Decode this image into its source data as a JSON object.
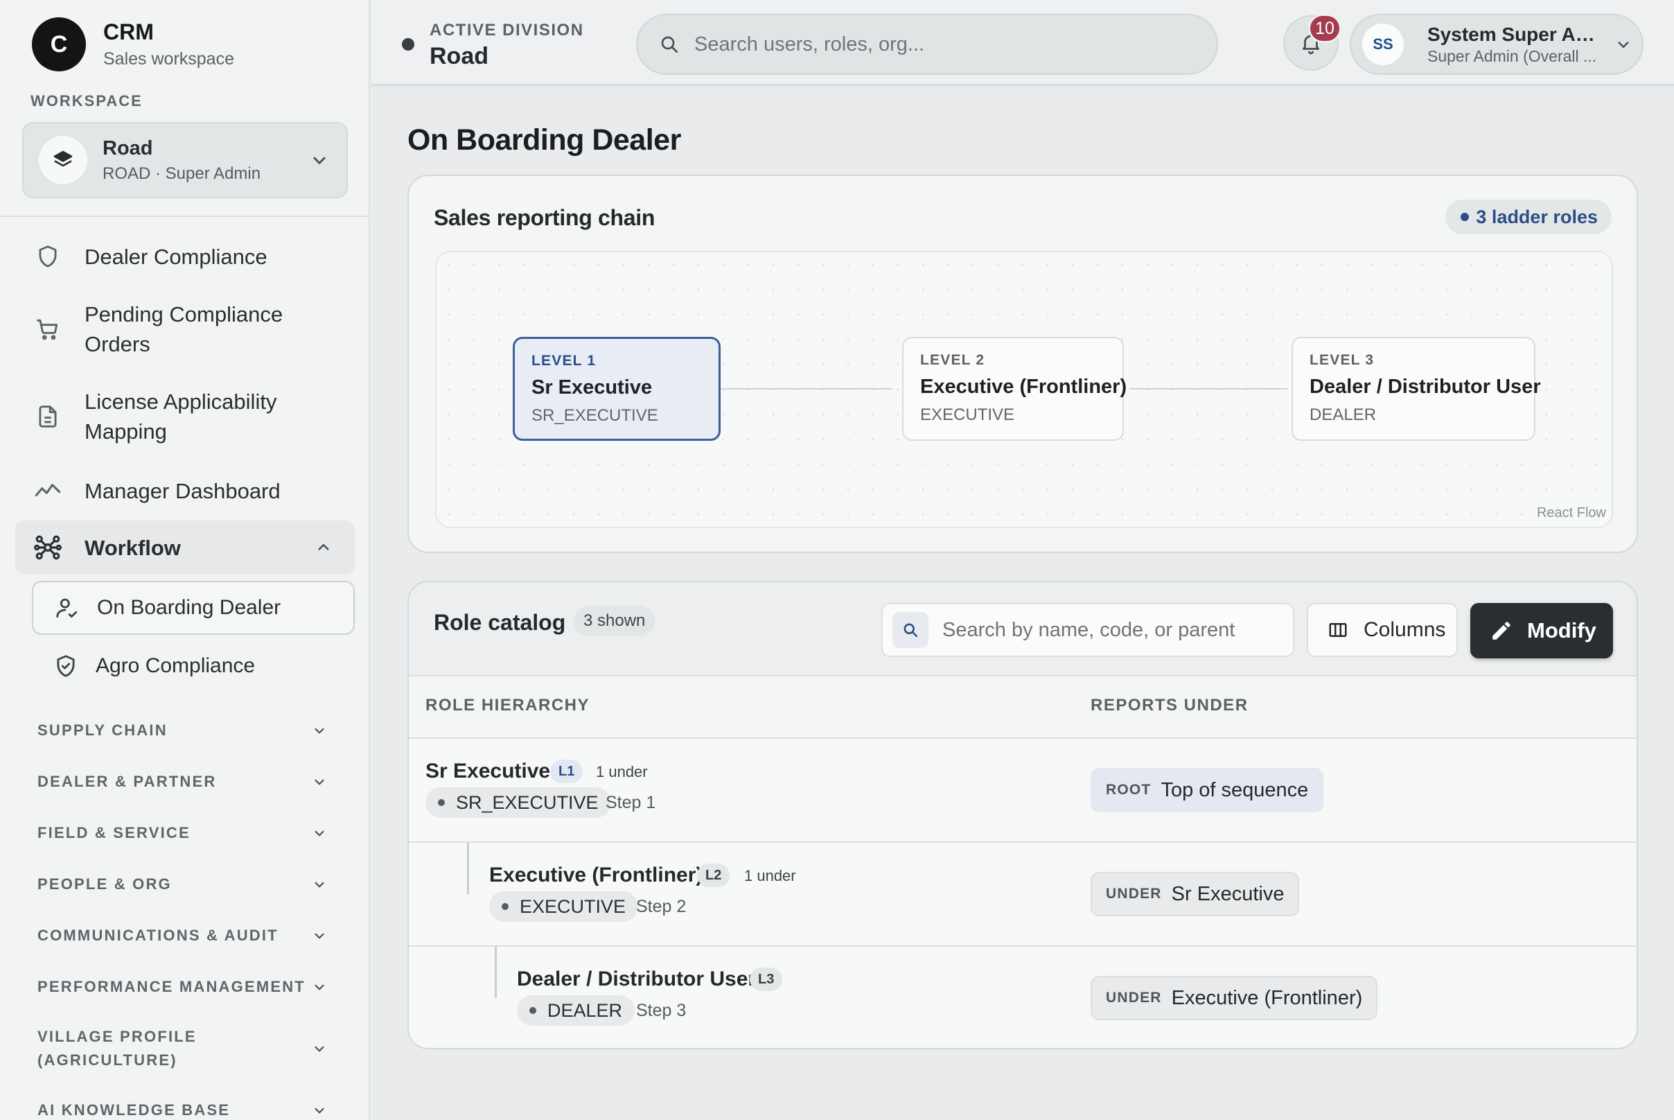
{
  "brand": {
    "logo_letter": "C",
    "name": "CRM",
    "subtitle": "Sales workspace"
  },
  "sidebar": {
    "workspace_label": "WORKSPACE",
    "workspace": {
      "name": "Road",
      "subtitle": "ROAD · Super Admin"
    },
    "items": [
      {
        "label": "Dealer Compliance",
        "icon": "shield-icon"
      },
      {
        "label": "Pending Compliance Orders",
        "icon": "cart-icon"
      },
      {
        "label": "License Applicability Mapping",
        "icon": "document-icon"
      },
      {
        "label": "Manager Dashboard",
        "icon": "trend-line-icon"
      }
    ],
    "workflow": {
      "label": "Workflow",
      "icon": "network-icon",
      "children": [
        {
          "label": "On Boarding Dealer",
          "icon": "user-check-icon",
          "active": true
        },
        {
          "label": "Agro Compliance",
          "icon": "shield-check-icon",
          "active": false
        }
      ]
    },
    "groups": [
      "SUPPLY CHAIN",
      "DEALER & PARTNER",
      "FIELD & SERVICE",
      "PEOPLE & ORG",
      "COMMUNICATIONS & AUDIT",
      "PERFORMANCE MANAGEMENT",
      "VILLAGE PROFILE (AGRICULTURE)",
      "AI KNOWLEDGE BASE"
    ]
  },
  "header": {
    "division_label": "ACTIVE DIVISION",
    "division_value": "Road",
    "search_placeholder": "Search users, roles, org...",
    "notifications": "10",
    "user": {
      "initials": "SS",
      "name": "System Super Ad...",
      "role": "Super Admin (Overall ..."
    }
  },
  "page": {
    "title": "On Boarding Dealer"
  },
  "chain": {
    "title": "Sales reporting chain",
    "badge": "3 ladder roles",
    "attribution": "React Flow",
    "nodes": [
      {
        "level": "LEVEL 1",
        "name": "Sr Executive",
        "code": "SR_EXECUTIVE",
        "selected": true
      },
      {
        "level": "LEVEL 2",
        "name": "Executive (Frontliner)",
        "code": "EXECUTIVE",
        "selected": false
      },
      {
        "level": "LEVEL 3",
        "name": "Dealer / Distributor User",
        "code": "DEALER",
        "selected": false
      }
    ]
  },
  "catalog": {
    "title": "Role catalog",
    "count": "3 shown",
    "search_placeholder": "Search by name, code, or parent",
    "columns_label": "Columns",
    "modify_label": "Modify",
    "headers": {
      "role": "ROLE HIERARCHY",
      "reports": "REPORTS UNDER"
    },
    "rows": [
      {
        "name": "Sr Executive",
        "level": "L1",
        "under": "1 under",
        "code": "SR_EXECUTIVE",
        "step": "Step 1",
        "rep_tag": "ROOT",
        "rep_value": "Top of sequence"
      },
      {
        "name": "Executive (Frontliner)",
        "level": "L2",
        "under": "1 under",
        "code": "EXECUTIVE",
        "step": "Step 2",
        "rep_tag": "UNDER",
        "rep_value": "Sr Executive"
      },
      {
        "name": "Dealer / Distributor User",
        "level": "L3",
        "under": "",
        "code": "DEALER",
        "step": "Step 3",
        "rep_tag": "UNDER",
        "rep_value": "Executive (Frontliner)"
      }
    ]
  },
  "colors": {
    "accent": "#2b4e86",
    "badge": "#a53b4e",
    "primary_button": "#2b2e31"
  }
}
